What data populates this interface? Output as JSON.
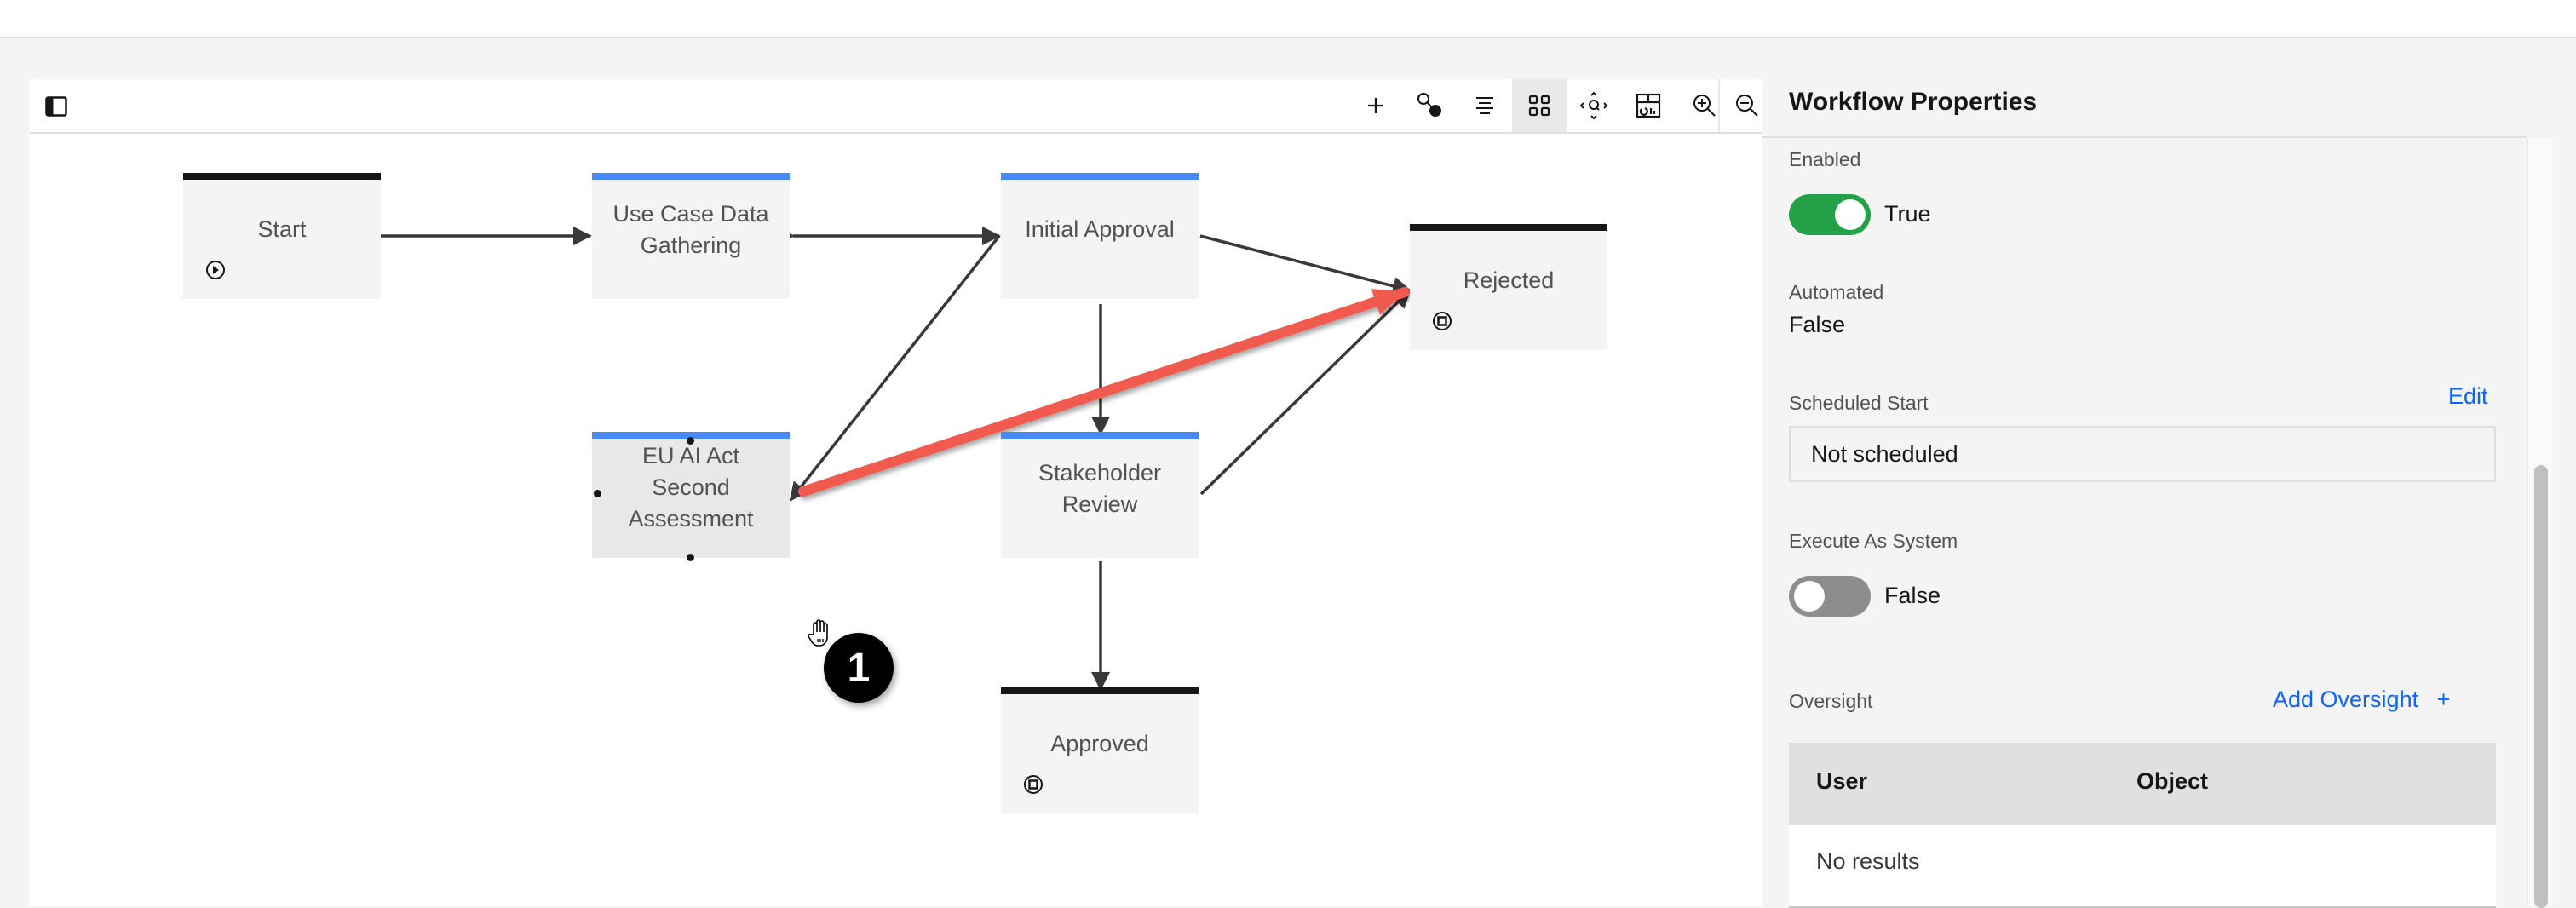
{
  "toolbar": {
    "buttons": [
      {
        "name": "add-node-button",
        "icon": "plus-icon",
        "active": false
      },
      {
        "name": "connect-button",
        "icon": "connect-icon",
        "active": false
      },
      {
        "name": "align-button",
        "icon": "align-center-icon",
        "active": false
      },
      {
        "name": "grid-view-button",
        "icon": "grid-icon",
        "active": true
      },
      {
        "name": "fit-view-button",
        "icon": "center-focus-icon",
        "active": false
      },
      {
        "name": "dashboard-button",
        "icon": "dashboard-icon",
        "active": false
      },
      {
        "name": "zoom-in-button",
        "icon": "zoom-in-icon",
        "active": false
      },
      {
        "name": "zoom-out-button",
        "icon": "zoom-out-icon",
        "active": false
      }
    ]
  },
  "workflow": {
    "nodes": [
      {
        "id": "start",
        "label": "Start",
        "type": "terminal-start",
        "bar_color": "#161616"
      },
      {
        "id": "use-case",
        "label": "Use Case Data Gathering",
        "type": "task",
        "bar_color": "#4589ff"
      },
      {
        "id": "initial-approval",
        "label": "Initial Approval",
        "type": "task",
        "bar_color": "#4589ff"
      },
      {
        "id": "rejected",
        "label": "Rejected",
        "type": "terminal-end",
        "bar_color": "#161616"
      },
      {
        "id": "eu-ai-act",
        "label": "EU AI Act Second Assessment",
        "type": "task",
        "bar_color": "#4589ff",
        "selected": true
      },
      {
        "id": "stakeholder",
        "label": "Stakeholder Review",
        "type": "task",
        "bar_color": "#4589ff"
      },
      {
        "id": "approved",
        "label": "Approved",
        "type": "terminal-end",
        "bar_color": "#161616"
      }
    ],
    "edges": [
      {
        "from": "start",
        "to": "use-case"
      },
      {
        "from": "use-case",
        "to": "initial-approval",
        "bidirectional": true
      },
      {
        "from": "initial-approval",
        "to": "eu-ai-act"
      },
      {
        "from": "initial-approval",
        "to": "rejected"
      },
      {
        "from": "initial-approval",
        "to": "stakeholder"
      },
      {
        "from": "stakeholder",
        "to": "rejected"
      },
      {
        "from": "stakeholder",
        "to": "approved"
      },
      {
        "from": "eu-ai-act",
        "to": "rejected",
        "highlighted": true,
        "color": "#f05a4f"
      }
    ],
    "annotation_badge": "1"
  },
  "panel": {
    "title": "Workflow Properties",
    "enabled": {
      "label": "Enabled",
      "value": "True",
      "on": true,
      "color": "#24a148"
    },
    "automated": {
      "label": "Automated",
      "value": "False"
    },
    "scheduled_start": {
      "label": "Scheduled Start",
      "edit_label": "Edit",
      "value": "Not scheduled"
    },
    "execute_as_system": {
      "label": "Execute As System",
      "value": "False",
      "on": false,
      "color": "#8d8d8d"
    },
    "oversight": {
      "label": "Oversight",
      "add_label": "Add Oversight",
      "columns": [
        "User",
        "Object"
      ],
      "empty_text": "No results"
    }
  }
}
